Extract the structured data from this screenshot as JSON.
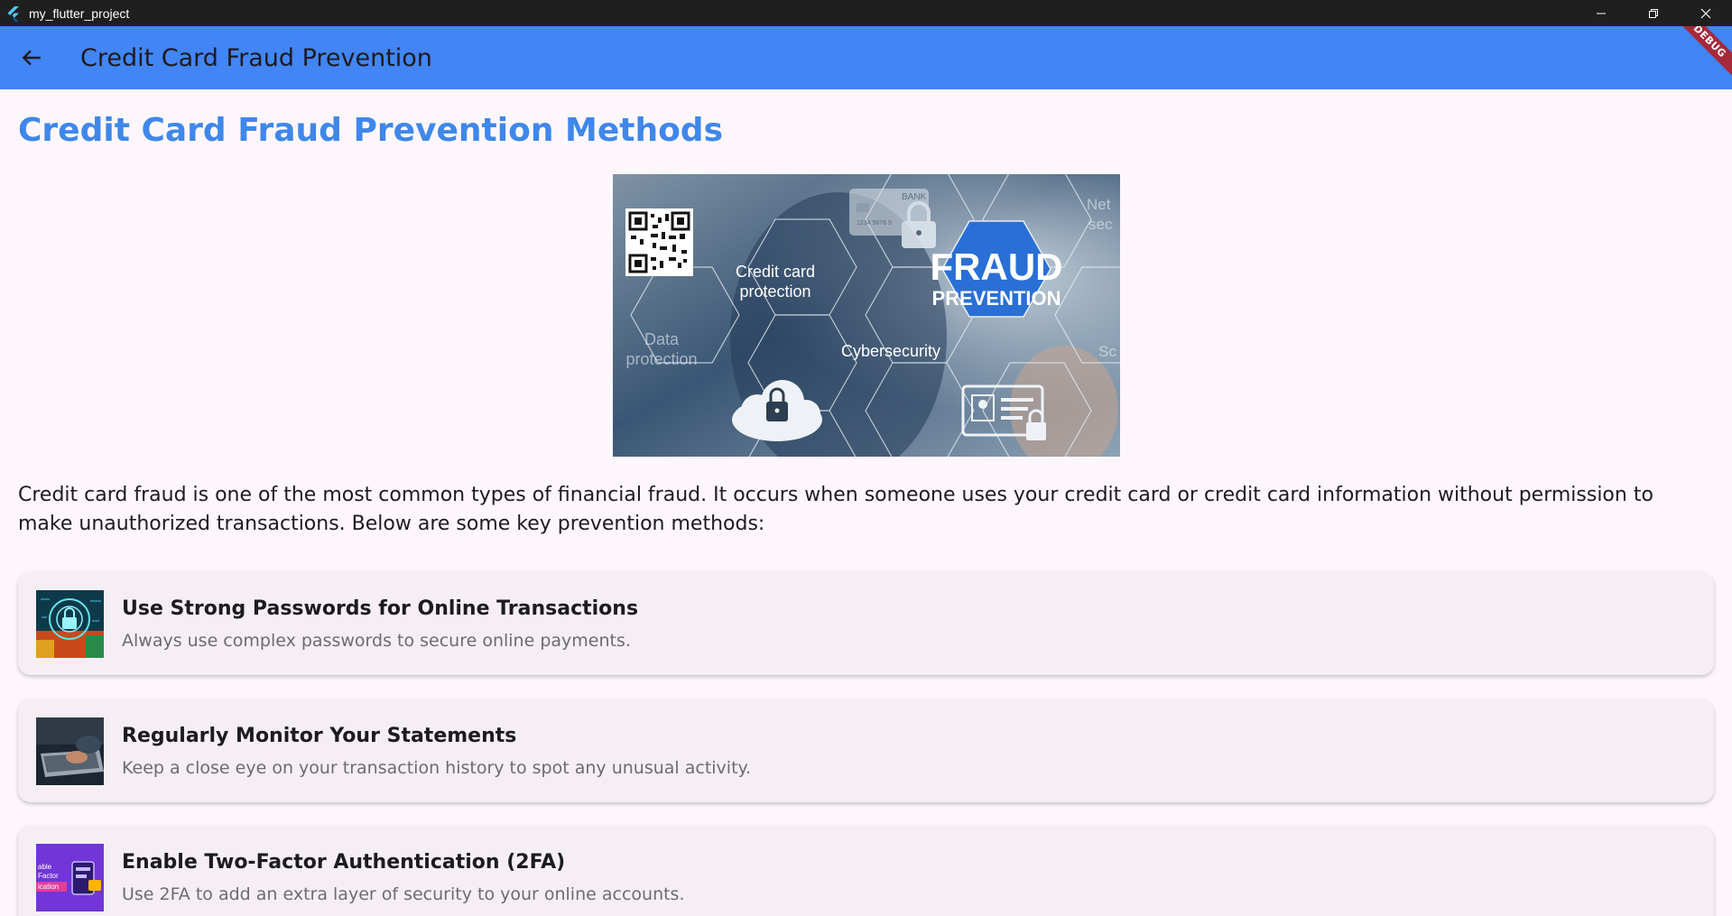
{
  "window": {
    "title": "my_flutter_project"
  },
  "appbar": {
    "title": "Credit Card Fraud Prevention",
    "debug_label": "DEBUG",
    "background_color": "#4285f4"
  },
  "page": {
    "heading": "Credit Card Fraud Prevention Methods",
    "heading_color": "#3f87ea",
    "intro": "Credit card fraud is one of the most common types of financial fraud. It occurs when someone uses your credit card or credit card information without permission to make unauthorized transactions. Below are some key prevention methods:"
  },
  "hero": {
    "labels": {
      "credit_card_protection_1": "Credit card",
      "credit_card_protection_2": "protection",
      "data_protection_1": "Data",
      "data_protection_2": "protection",
      "cybersecurity": "Cybersecurity",
      "fraud": "FRAUD",
      "prevention": "PREVENTION",
      "bank": "BANK",
      "card_number": "1234 5678 9",
      "network_1": "Net",
      "network_2": "sec",
      "partial": "Sc"
    }
  },
  "methods": [
    {
      "title": "Use Strong Passwords for Online Transactions",
      "subtitle": "Always use complex passwords to secure online payments.",
      "icon": "padlock-circuit-image"
    },
    {
      "title": "Regularly Monitor Your Statements",
      "subtitle": "Keep a close eye on your transaction history to spot any unusual activity.",
      "icon": "laptop-typing-image"
    },
    {
      "title": "Enable Two-Factor Authentication (2FA)",
      "subtitle": "Use 2FA to add an extra layer of security to your online accounts.",
      "icon": "two-factor-image",
      "thumb_text": [
        "able",
        "Factor",
        "ication"
      ]
    }
  ]
}
